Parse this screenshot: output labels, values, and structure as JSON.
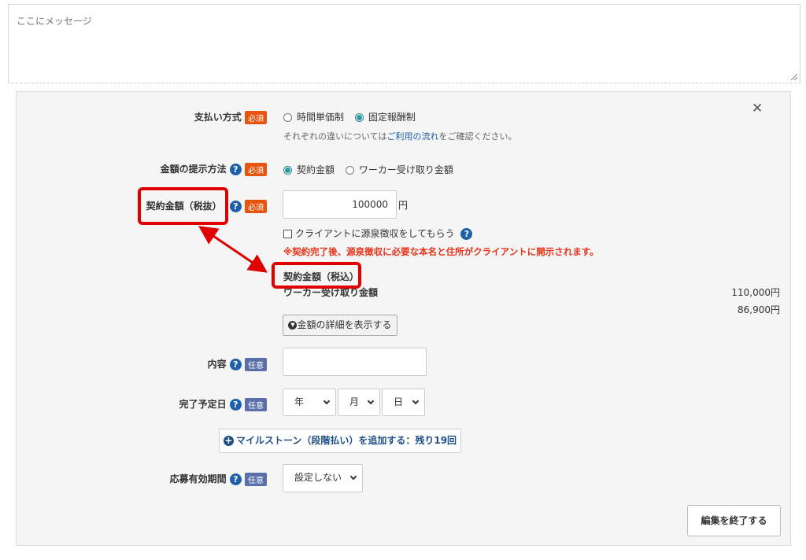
{
  "message": {
    "placeholder": "ここにメッセージ"
  },
  "form": {
    "payment_method": {
      "label": "支払い方式",
      "badge": "必須",
      "options": [
        "時間単価制",
        "固定報酬制"
      ],
      "selected": "固定報酬制",
      "note_pre": "それぞれの違いについては",
      "note_link": "ご利用の流れ",
      "note_post": "をご確認ください。"
    },
    "amount_presentation": {
      "label": "金額の提示方法",
      "badge": "必須",
      "options": [
        "契約金額",
        "ワーカー受け取り金額"
      ],
      "selected": "契約金額"
    },
    "contract_amount": {
      "label": "契約金額（税抜）",
      "badge": "必須",
      "value": "100000",
      "unit": "円",
      "withholding_label": "クライアントに源泉徴収をしてもらう",
      "warning": "※契約完了後、源泉徴収に必要な本名と住所がクライアントに開示されます。"
    },
    "summary": {
      "tax_included_label": "契約金額（税込）",
      "worker_label": "ワーカー受け取り金額",
      "tax_included_value": "110,000円",
      "worker_value": "86,900円",
      "details_button": "金額の詳細を表示する"
    },
    "content": {
      "label": "内容",
      "badge": "任意",
      "value": ""
    },
    "due_date": {
      "label": "完了予定日",
      "badge": "任意",
      "year": "年",
      "month": "月",
      "day": "日"
    },
    "milestone_button": "マイルストーン（段階払い）を追加する：残り19回",
    "validity": {
      "label": "応募有効期間",
      "badge": "任意",
      "value": "設定しない"
    },
    "finish_button": "編集を終了する"
  },
  "icons": {
    "close": "close-icon",
    "help": "question-circle-icon",
    "add": "plus-circle-icon",
    "expand": "chevron-down-circle-icon"
  },
  "colors": {
    "required_badge": "#e8530d",
    "optional_badge": "#5a6fa8",
    "help_icon": "#1d5fa8",
    "warning_text": "#e8321a",
    "annotation_red": "#e00000",
    "panel_bg": "#f5f5f5"
  }
}
